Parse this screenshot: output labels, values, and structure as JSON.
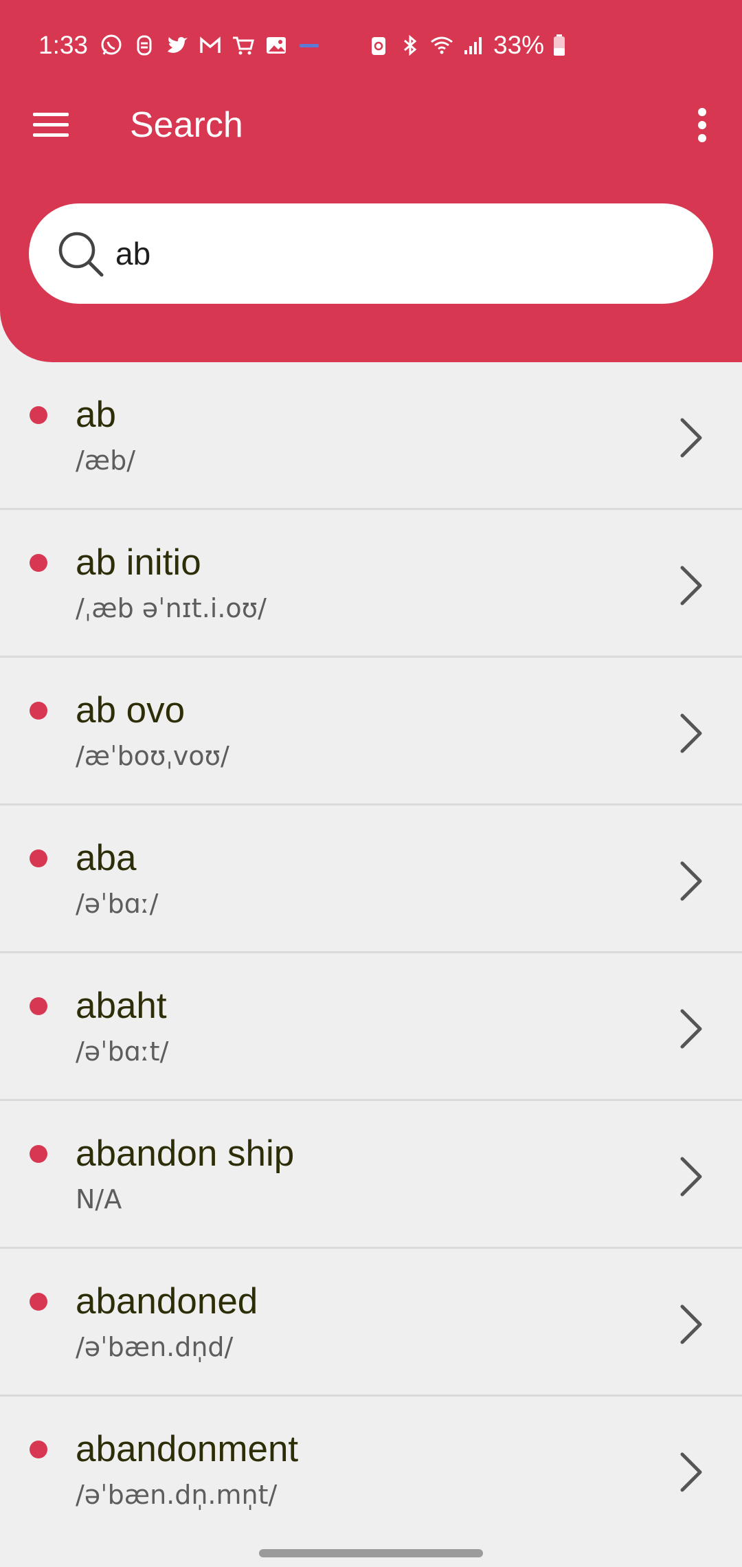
{
  "status_bar": {
    "time": "1:33",
    "left_icons": [
      "whatsapp-icon",
      "messenger-icon",
      "twitter-icon",
      "gmail-icon",
      "shopping-cart-icon",
      "gallery-icon",
      "notification-dots-icon"
    ],
    "right_icons": [
      "battery-saver-icon",
      "bluetooth-icon",
      "wifi-icon",
      "signal-icon"
    ],
    "battery": "33%"
  },
  "appbar": {
    "title": "Search",
    "menu_icon": "hamburger-menu-icon",
    "more_icon": "more-vertical-icon"
  },
  "search": {
    "value": "ab",
    "icon": "search-icon"
  },
  "colors": {
    "accent": "#d73751",
    "background": "#efefef",
    "word_text": "#2d2e08",
    "pron_text": "#5d5d5d"
  },
  "results": [
    {
      "word": "ab",
      "pron": "/æb/"
    },
    {
      "word": "ab initio",
      "pron": "/ˌæb əˈnɪt.i.oʊ/"
    },
    {
      "word": "ab ovo",
      "pron": "/æˈboʊˌvoʊ/"
    },
    {
      "word": "aba",
      "pron": "/əˈbɑː/"
    },
    {
      "word": "abaht",
      "pron": "/əˈbɑːt/"
    },
    {
      "word": "abandon ship",
      "pron": "N/A"
    },
    {
      "word": "abandoned",
      "pron": "/əˈbæn.dn̩d/"
    },
    {
      "word": "abandonment",
      "pron": "/əˈbæn.dn̩.mn̩t/"
    }
  ]
}
